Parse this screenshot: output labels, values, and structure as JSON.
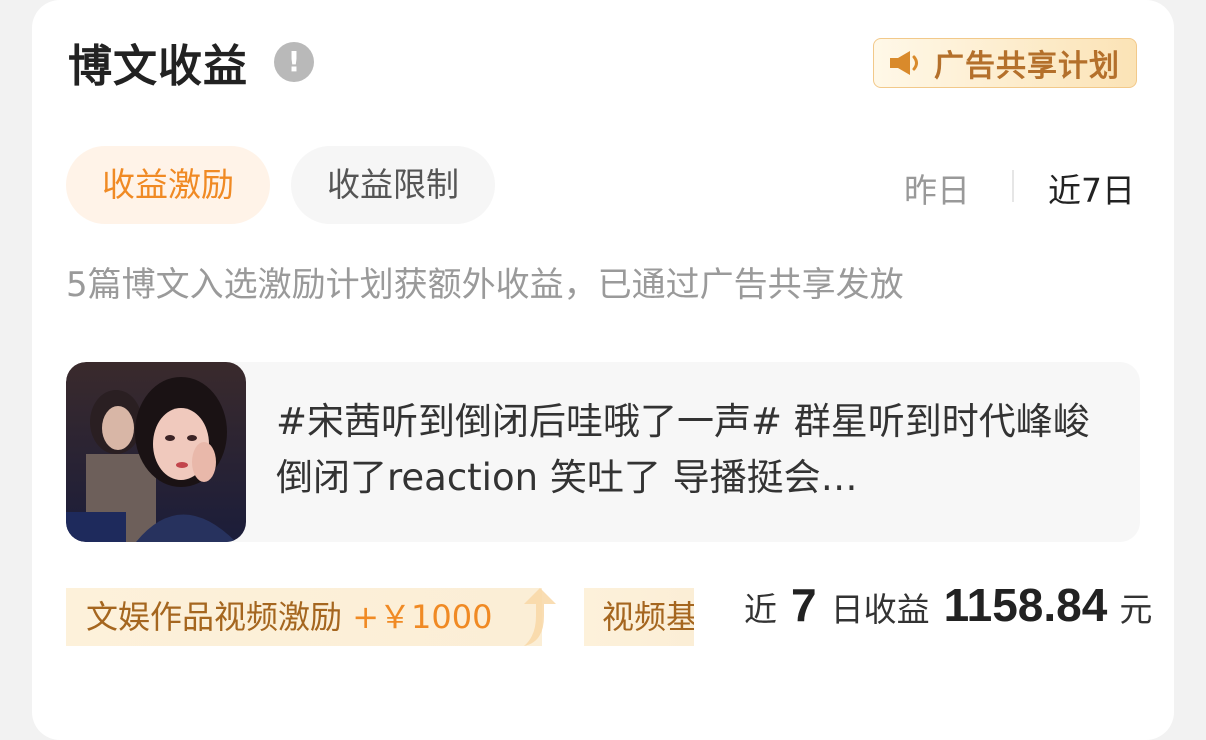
{
  "header": {
    "title": "博文收益",
    "ad_plan_label": "广告共享计划"
  },
  "tabs": [
    {
      "label": "收益激励",
      "active": true
    },
    {
      "label": "收益限制",
      "active": false
    }
  ],
  "range": {
    "yesterday": "昨日",
    "last7": "近7日",
    "selected": "近7日"
  },
  "description": "5篇博文入选激励计划获额外收益，已通过广告共享发放",
  "post": {
    "text": "#宋茜听到倒闭后哇哦了一声# 群星听到时代峰峻倒闭了reaction 笑吐了 导播挺会…"
  },
  "rewards": [
    {
      "label": "文娱作品视频激励",
      "amount": "+￥1000"
    },
    {
      "label": "视频基"
    }
  ],
  "earnings": {
    "prefix": "近",
    "days": "7",
    "middle": "日收益",
    "amount": "1158.84",
    "unit": "元"
  },
  "colors": {
    "accent": "#f08a24",
    "gold_text": "#b4702b"
  }
}
